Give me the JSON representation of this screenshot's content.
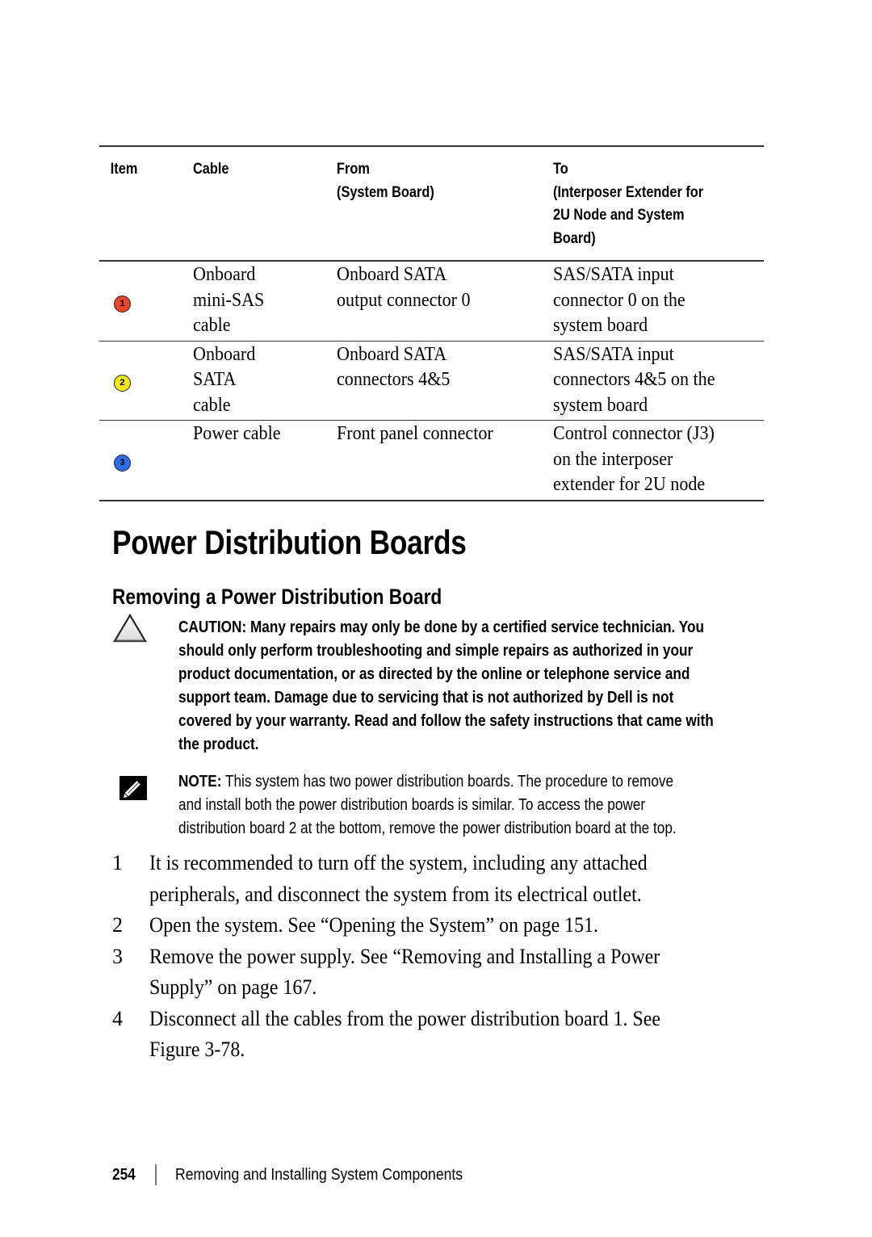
{
  "table": {
    "headers": {
      "item": "Item",
      "cable": "Cable",
      "from": [
        "From",
        "(System Board)"
      ],
      "to": [
        "To",
        "(Interposer Extender for",
        "2U Node and System",
        "Board)"
      ]
    },
    "rows": [
      {
        "item": "1",
        "badge_color": "#e8452a",
        "cable": [
          "Onboard",
          "mini-SAS",
          "cable"
        ],
        "from": [
          "Onboard SATA",
          "output connector 0"
        ],
        "to": [
          "SAS/SATA input",
          "connector 0 on the",
          "system board"
        ]
      },
      {
        "item": "2",
        "badge_color": "#f3e81e",
        "cable": [
          "Onboard",
          "SATA",
          "cable"
        ],
        "from": [
          "Onboard SATA",
          "connectors 4&5"
        ],
        "to": [
          "SAS/SATA input",
          "connectors 4&5 on the",
          "system board"
        ]
      },
      {
        "item": "3",
        "badge_color": "#2f6de8",
        "cable": [
          "Power cable"
        ],
        "from": [
          "Front panel connector"
        ],
        "to": [
          "Control connector (J3)",
          "on the interposer",
          "extender for 2U node"
        ]
      }
    ]
  },
  "section_title": "Power Distribution Boards",
  "subsection_title": "Removing a Power Distribution Board",
  "caution": {
    "icon": "caution-triangle-icon",
    "lines": [
      "CAUTION: Many repairs may only be done by a certified service technician. You",
      "should only perform troubleshooting and simple repairs as authorized in your",
      "product documentation, or as directed by the online or telephone service and",
      "support team. Damage due to servicing that is not authorized by Dell is not",
      "covered by your warranty. Read and follow the safety instructions that came with",
      "the product."
    ]
  },
  "note": {
    "icon": "pencil-note-icon",
    "label": "NOTE:",
    "lines": [
      " This system has two power distribution boards. The procedure to remove",
      "and install both the power distribution boards is similar. To access the power",
      "distribution board 2 at the bottom, remove the power distribution board at the top."
    ]
  },
  "steps": [
    {
      "num": "1",
      "lines": [
        "It is recommended to turn off the system, including any attached",
        "peripherals, and disconnect the system from its electrical outlet."
      ]
    },
    {
      "num": "2",
      "lines": [
        "Open the system. See “Opening the System” on page 151."
      ]
    },
    {
      "num": "3",
      "lines": [
        "Remove the power supply. See “Removing and Installing a Power",
        "Supply” on page 167."
      ]
    },
    {
      "num": "4",
      "lines": [
        "Disconnect all the cables from the power distribution board 1. See",
        "Figure 3-78."
      ]
    }
  ],
  "footer": {
    "page_number": "254",
    "chapter_title": "Removing and Installing System Components"
  }
}
